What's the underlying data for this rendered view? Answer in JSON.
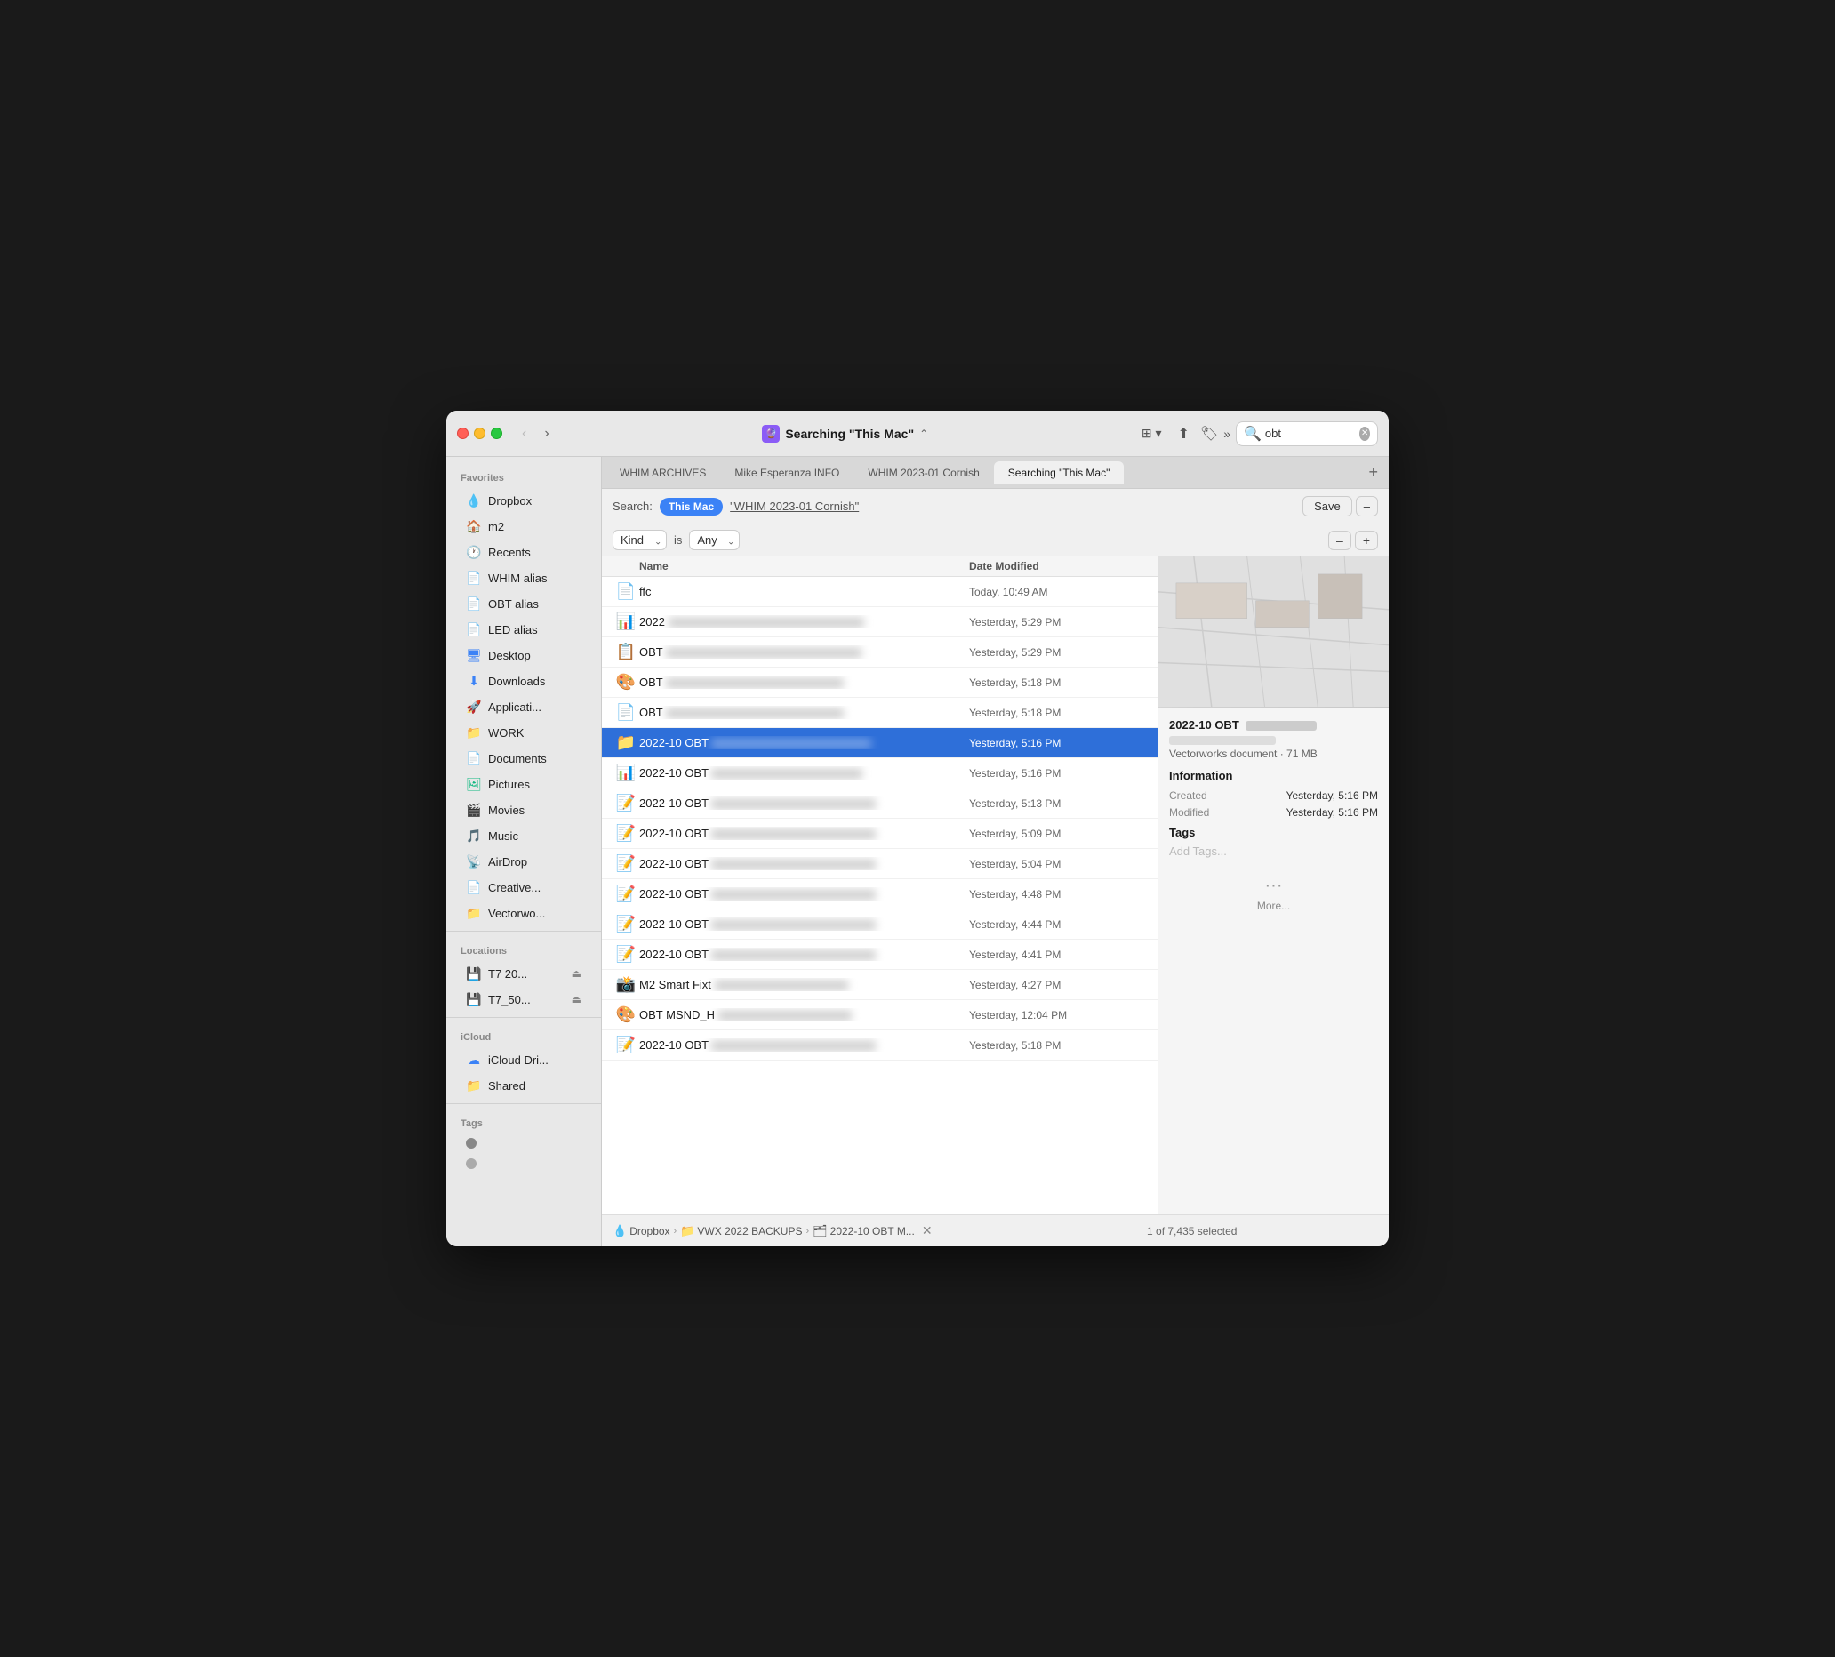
{
  "window": {
    "title": "Searching \"This Mac\"",
    "title_icon": "🗂"
  },
  "titlebar": {
    "back_label": "‹",
    "forward_label": "›",
    "search_placeholder": "obt",
    "search_value": "obt"
  },
  "tabs": [
    {
      "label": "WHIM ARCHIVES",
      "active": false
    },
    {
      "label": "Mike Esperanza INFO",
      "active": false
    },
    {
      "label": "WHIM 2023-01 Cornish",
      "active": false
    },
    {
      "label": "Searching \"This Mac\"",
      "active": true
    }
  ],
  "search_bar": {
    "label": "Search:",
    "scope_this_mac": "This Mac",
    "scope_cornish": "\"WHIM 2023-01 Cornish\"",
    "save_label": "Save",
    "minus_label": "–"
  },
  "filter_row": {
    "kind_label": "Kind",
    "is_label": "is",
    "any_label": "Any",
    "minus_label": "–",
    "plus_label": "+"
  },
  "columns": {
    "name": "Name",
    "date": "Date Modified"
  },
  "files": [
    {
      "icon": "📄",
      "name": "ffc",
      "name_blur": "",
      "date": "Today, 10:49 AM",
      "selected": false
    },
    {
      "icon": "📊",
      "name": "2022",
      "name_blur": "blur_long",
      "date": "Yesterday, 5:29 PM",
      "selected": false
    },
    {
      "icon": "📋",
      "name": "OBT",
      "name_blur": "blur_long",
      "date": "Yesterday, 5:29 PM",
      "selected": false
    },
    {
      "icon": "🎨",
      "name": "OBT",
      "name_blur": "blur_long",
      "date": "Yesterday, 5:18 PM",
      "selected": false
    },
    {
      "icon": "📄",
      "name": "OBT",
      "name_blur": "blur_long",
      "date": "Yesterday, 5:18 PM",
      "selected": false
    },
    {
      "icon": "📁",
      "name": "2022-10 OBT",
      "name_blur": "blur_long",
      "date": "Yesterday, 5:16 PM",
      "selected": true
    },
    {
      "icon": "📊",
      "name": "2022-10 OBT",
      "name_blur": "blur_long",
      "date": "Yesterday, 5:16 PM",
      "selected": false
    },
    {
      "icon": "📝",
      "name": "2022-10 OBT",
      "name_blur": "blur_long",
      "date": "Yesterday, 5:13 PM",
      "selected": false
    },
    {
      "icon": "📝",
      "name": "2022-10 OBT",
      "name_blur": "blur_long",
      "date": "Yesterday, 5:09 PM",
      "selected": false
    },
    {
      "icon": "📝",
      "name": "2022-10 OBT",
      "name_blur": "blur_long",
      "date": "Yesterday, 5:04 PM",
      "selected": false
    },
    {
      "icon": "📝",
      "name": "2022-10 OBT",
      "name_blur": "blur_long",
      "date": "Yesterday, 4:48 PM",
      "selected": false
    },
    {
      "icon": "📝",
      "name": "2022-10 OBT",
      "name_blur": "blur_long",
      "date": "Yesterday, 4:44 PM",
      "selected": false
    },
    {
      "icon": "📝",
      "name": "2022-10 OBT",
      "name_blur": "blur_long",
      "date": "Yesterday, 4:41 PM",
      "selected": false
    },
    {
      "icon": "📸",
      "name": "M2 Smart Fixt",
      "name_blur": "blur_long",
      "date": "Yesterday, 4:27 PM",
      "selected": false
    },
    {
      "icon": "🎨",
      "name": "OBT MSND_H",
      "name_blur": "blur_long",
      "date": "Yesterday, 12:04 PM",
      "selected": false
    },
    {
      "icon": "📝",
      "name": "2022-10 OBT",
      "name_blur": "blur_long",
      "date": "Yesterday, 5:18 PM",
      "selected": false
    }
  ],
  "preview": {
    "filename": "2022-10 OBT",
    "filename_blur": "blur",
    "subtitle_blur": "blur",
    "type": "Vectorworks document · 71 MB",
    "info_section": "Information",
    "created_label": "Created",
    "created_value": "Yesterday, 5:16 PM",
    "modified_label": "Modified",
    "modified_value": "Yesterday, 5:16 PM",
    "tags_section": "Tags",
    "add_tags": "Add Tags...",
    "more_label": "More..."
  },
  "status_bar": {
    "path": [
      "Dropbox",
      "VWX 2022 BACKUPS",
      "2022-10 OBT M..."
    ],
    "path_icons": [
      "💧",
      "📁",
      "🗂"
    ],
    "selected_text": "1 of 7,435 selected"
  },
  "sidebar": {
    "favorites_label": "Favorites",
    "items_favorites": [
      {
        "icon": "💧",
        "label": "Dropbox",
        "icon_class": "si-blue"
      },
      {
        "icon": "🏠",
        "label": "m2",
        "icon_class": "si-orange"
      },
      {
        "icon": "🕐",
        "label": "Recents",
        "icon_class": "si-orange"
      },
      {
        "icon": "📄",
        "label": "WHIM alias",
        "icon_class": "si-gray"
      },
      {
        "icon": "📄",
        "label": "OBT alias",
        "icon_class": "si-gray"
      },
      {
        "icon": "📄",
        "label": "LED alias",
        "icon_class": "si-gray"
      },
      {
        "icon": "🖥",
        "label": "Desktop",
        "icon_class": "si-blue"
      },
      {
        "icon": "⬇",
        "label": "Downloads",
        "icon_class": "si-blue"
      },
      {
        "icon": "🚀",
        "label": "Applicati...",
        "icon_class": "si-gray"
      },
      {
        "icon": "📁",
        "label": "WORK",
        "icon_class": "si-blue"
      },
      {
        "icon": "📄",
        "label": "Documents",
        "icon_class": "si-gray"
      },
      {
        "icon": "🖼",
        "label": "Pictures",
        "icon_class": "si-green"
      },
      {
        "icon": "🎬",
        "label": "Movies",
        "icon_class": "si-gray"
      },
      {
        "icon": "🎵",
        "label": "Music",
        "icon_class": "si-pink"
      },
      {
        "icon": "📡",
        "label": "AirDrop",
        "icon_class": "si-blue"
      },
      {
        "icon": "📄",
        "label": "Creative...",
        "icon_class": "si-gray"
      },
      {
        "icon": "📁",
        "label": "Vectorwo...",
        "icon_class": "si-blue"
      }
    ],
    "locations_label": "Locations",
    "items_locations": [
      {
        "icon": "💾",
        "label": "T7 20...",
        "eject": true
      },
      {
        "icon": "💾",
        "label": "T7_50...",
        "eject": true
      }
    ],
    "icloud_label": "iCloud",
    "items_icloud": [
      {
        "icon": "☁",
        "label": "iCloud Dri...",
        "icon_class": "si-blue"
      },
      {
        "icon": "📁",
        "label": "Shared",
        "icon_class": "si-blue"
      }
    ],
    "tags_label": "Tags",
    "items_tags": [
      {
        "color": "#888888"
      },
      {
        "color": "#aaaaaa"
      }
    ]
  }
}
